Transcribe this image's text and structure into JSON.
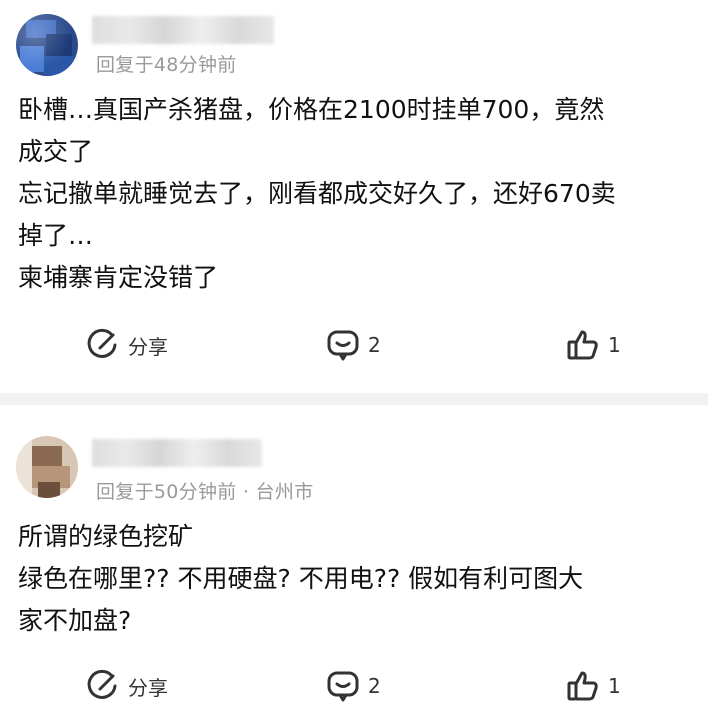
{
  "toolbar": {
    "icons": [
      "copy-icon",
      "shuffle-icon",
      "save-icon",
      "edit-icon",
      "share-icon"
    ]
  },
  "comments": [
    {
      "meta": "回复于48分钟前",
      "lines": [
        "卧槽…真国产杀猪盘，价格在2100时挂单700，竟然",
        "成交了",
        "忘记撤单就睡觉去了，刚看都成交好久了，还好670卖",
        "掉了…",
        "柬埔寨肯定没错了"
      ],
      "actions": {
        "share_label": "分享",
        "comment_count": "2",
        "like_count": "1"
      }
    },
    {
      "meta": "回复于50分钟前 · 台州市",
      "lines": [
        "所谓的绿色挖矿",
        "绿色在哪里?? 不用硬盘? 不用电?? 假如有利可图大",
        "家不加盘?"
      ],
      "actions": {
        "share_label": "分享",
        "comment_count": "2",
        "like_count": "1"
      }
    }
  ],
  "colors": {
    "accent": "#2c9f57",
    "meta": "#9a9a9a",
    "divider": "#f2f2f4"
  }
}
